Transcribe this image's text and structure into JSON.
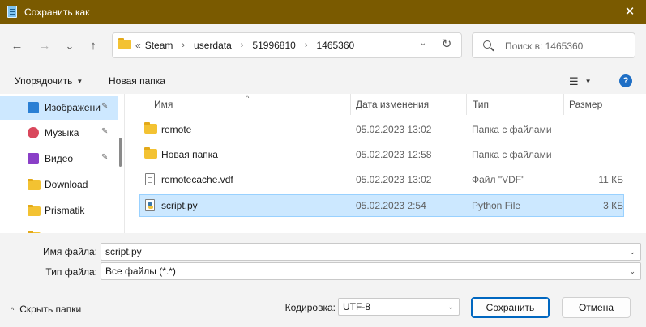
{
  "window": {
    "title": "Сохранить как",
    "title_icon": "notepad-icon",
    "close_glyph": "✕"
  },
  "nav": {
    "back_glyph": "←",
    "forward_glyph": "→",
    "recent_glyph": "⌄",
    "up_glyph": "↑",
    "address": {
      "lead": "«",
      "crumbs": [
        "Steam",
        "userdata",
        "51996810",
        "1465360"
      ],
      "separator": "›",
      "dropdown_glyph": "⌄",
      "refresh_glyph": "↻"
    },
    "search_placeholder": "Поиск в: 1465360"
  },
  "toolbar": {
    "organize_label": "Упорядочить",
    "new_folder_label": "Новая папка",
    "view_glyph": "☰",
    "help_glyph": "?"
  },
  "sidebar": {
    "items": [
      {
        "label": "Изображени",
        "icon": "pictures-icon",
        "color": "#2a7fd4",
        "pinned": true,
        "selected": true
      },
      {
        "label": "Музыка",
        "icon": "music-icon",
        "color": "#d9475c",
        "pinned": true,
        "selected": false
      },
      {
        "label": "Видео",
        "icon": "video-icon",
        "color": "#8a3fc7",
        "pinned": true,
        "selected": false
      },
      {
        "label": "Download",
        "icon": "folder-icon",
        "color": "#f3c232",
        "pinned": false,
        "selected": false
      },
      {
        "label": "Prismatik",
        "icon": "folder-icon",
        "color": "#f3c232",
        "pinned": false,
        "selected": false
      },
      {
        "label": "",
        "icon": "folder-icon",
        "color": "#f3c232",
        "pinned": false,
        "selected": false
      }
    ],
    "pin_glyph": "📌"
  },
  "list": {
    "columns": {
      "name": "Имя",
      "date": "Дата изменения",
      "type": "Тип",
      "size": "Размер"
    },
    "sort_glyph": "^",
    "rows": [
      {
        "name": "remote",
        "date": "05.02.2023 13:02",
        "type": "Папка с файлами",
        "size": "",
        "icon": "folder-icon",
        "selected": false
      },
      {
        "name": "Новая папка",
        "date": "05.02.2023 12:58",
        "type": "Папка с файлами",
        "size": "",
        "icon": "folder-icon",
        "selected": false
      },
      {
        "name": "remotecache.vdf",
        "date": "05.02.2023 13:02",
        "type": "Файл \"VDF\"",
        "size": "11 КБ",
        "icon": "file-icon",
        "selected": false
      },
      {
        "name": "script.py",
        "date": "05.02.2023 2:54",
        "type": "Python File",
        "size": "3 КБ",
        "icon": "python-file-icon",
        "selected": true
      }
    ]
  },
  "form": {
    "filename_label": "Имя файла:",
    "filename_value": "script.py",
    "filetype_label": "Тип файла:",
    "filetype_value": "Все файлы  (*.*)",
    "encoding_label": "Кодировка:",
    "encoding_value": "UTF-8",
    "dropdown_glyph": "⌄"
  },
  "footer": {
    "hide_folders_label": "Скрыть папки",
    "hide_glyph": "^",
    "save_label": "Сохранить",
    "cancel_label": "Отмена"
  },
  "colors": {
    "titlebar": "#7a5a00",
    "accent": "#0067c0",
    "selection": "#cce8ff"
  }
}
